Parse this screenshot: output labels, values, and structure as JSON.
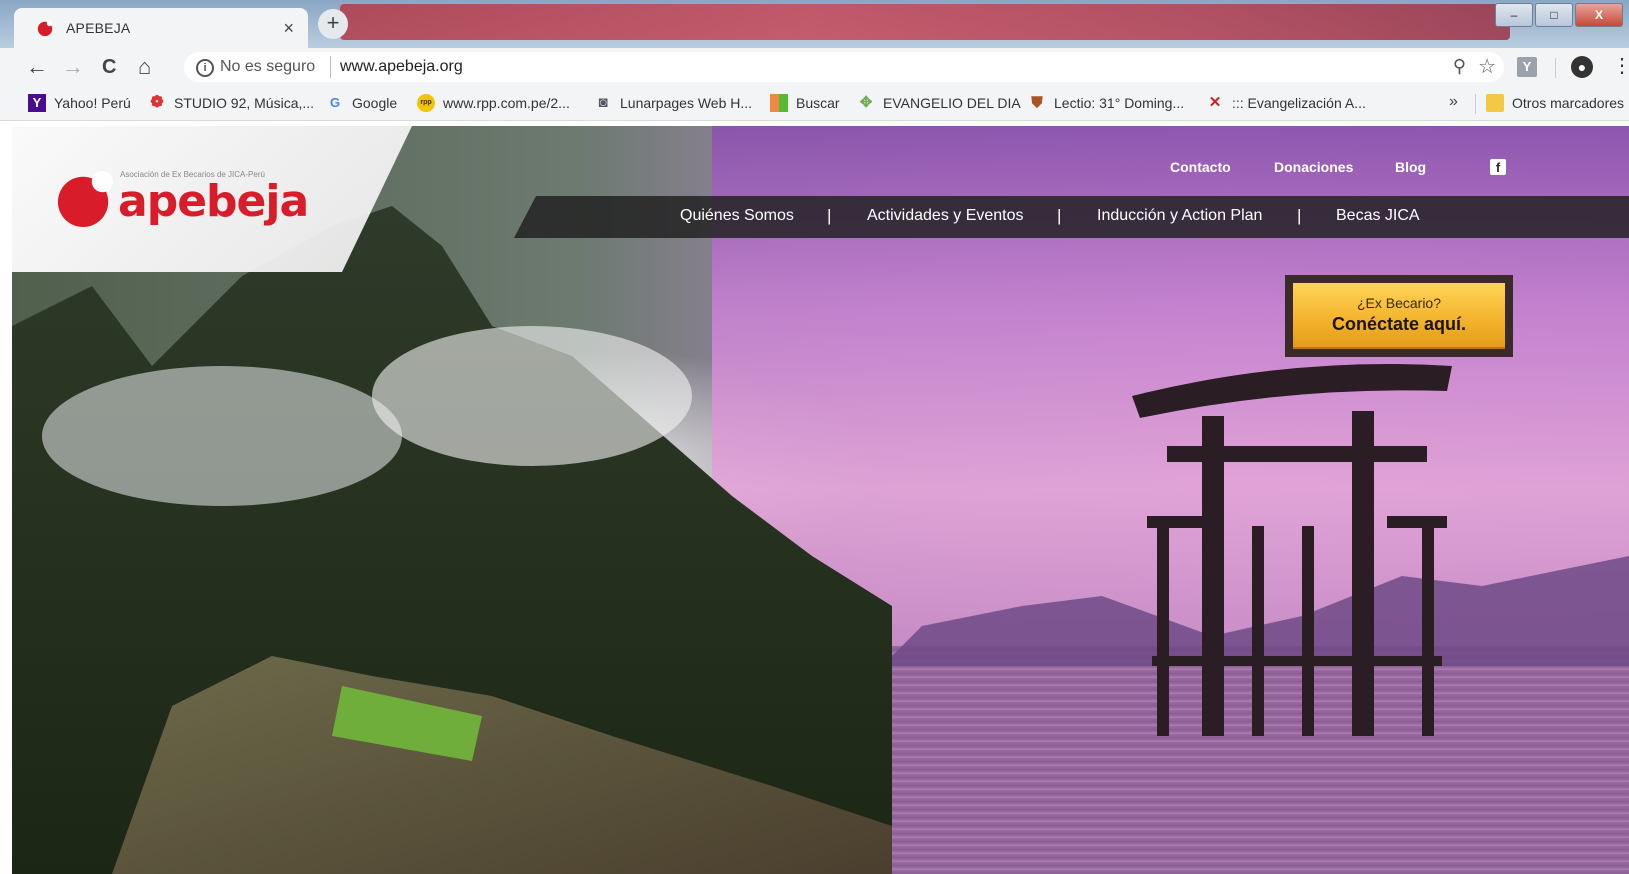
{
  "browser": {
    "tab_title": "APEBEJA",
    "tab_close": "×",
    "new_tab": "+",
    "window_buttons": [
      "–",
      "□",
      "X"
    ],
    "nav_icons": {
      "back": "←",
      "forward": "→",
      "reload": "C",
      "home": "⌂"
    },
    "address": {
      "security_label": "No es seguro",
      "url": "www.apebeja.org"
    }
  },
  "bookmarks": {
    "items": [
      {
        "label": "Yahoo! Perú",
        "icon": "yahoo-icon"
      },
      {
        "label": "STUDIO 92, Música,...",
        "icon": "studio92-icon"
      },
      {
        "label": "Google",
        "icon": "google-icon"
      },
      {
        "label": "www.rpp.com.pe/2...",
        "icon": "rpp-icon"
      },
      {
        "label": "Lunarpages Web H...",
        "icon": "lunarpages-icon"
      },
      {
        "label": "Buscar",
        "icon": "windows-icon"
      },
      {
        "label": "EVANGELIO DEL DIA",
        "icon": "cross-icon"
      },
      {
        "label": "Lectio: 31° Doming...",
        "icon": "shield-icon"
      },
      {
        "label": "::: Evangelización A...",
        "icon": "ea-icon"
      }
    ],
    "more": "»",
    "other_label": "Otros marcadores"
  },
  "site": {
    "logo": {
      "subtitle": "Asociación de Ex Becarios de JICA-Perú",
      "wordmark": "apebeja"
    },
    "top_links": [
      "Contacto",
      "Donaciones",
      "Blog"
    ],
    "nav": [
      "Quiénes Somos",
      "Actividades y Eventos",
      "Inducción y Action Plan",
      "Becas JICA"
    ],
    "nav_separator": "|",
    "cta": {
      "small": "¿Ex Becario?",
      "big": "Conéctate aquí."
    }
  },
  "colors": {
    "brand_red": "#d91c2a",
    "cta_yellow": "#f4b52e",
    "nav_bg": "#1e1e1e"
  }
}
